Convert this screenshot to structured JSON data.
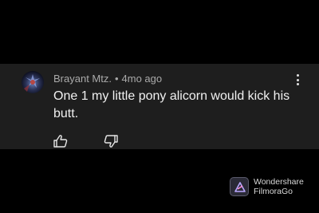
{
  "comment": {
    "author": "Brayant Mtz.",
    "separator": "•",
    "time": "4mo ago",
    "text": "One 1 my little pony alicorn would kick his butt."
  },
  "icons": {
    "more": "more-vertical-icon",
    "like": "thumbs-up-icon",
    "dislike": "thumbs-down-icon"
  },
  "watermark": {
    "line1": "Wondershare",
    "line2": "FilmoraGo"
  }
}
